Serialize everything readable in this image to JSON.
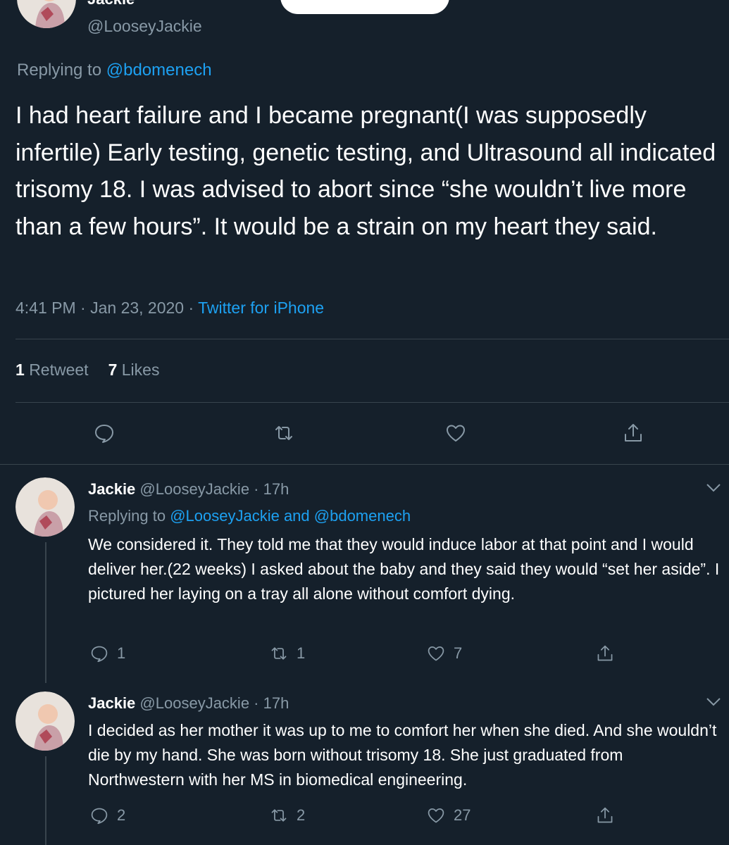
{
  "main_tweet": {
    "name": "Jackie",
    "handle": "@LooseyJackie",
    "replying_prefix": "Replying to",
    "replying_to": "@bdomenech",
    "text": "I had heart failure and I became pregnant(I was supposedly infertile) Early testing, genetic testing, and Ultrasound all indicated trisomy 18. I was advised to abort since “she wouldn’t live more than a few hours”. It would be a strain on my heart they said.",
    "time": "4:41 PM · Jan 23, 2020 · ",
    "source": "Twitter for iPhone",
    "retweet_count": "1",
    "retweet_label": "Retweet",
    "like_count": "7",
    "like_label": "Likes"
  },
  "replies": [
    {
      "name": "Jackie",
      "handle_time": "@LooseyJackie · 17h",
      "replying_prefix": "Replying to",
      "replying_to": "@LooseyJackie and @bdomenech",
      "text": "We considered it. They told me that they would induce labor at that point and I would deliver her.(22 weeks) I asked about the baby and they said they would “set her aside”. I pictured her laying on a tray all alone without comfort dying.",
      "reply_count": "1",
      "retweet_count": "1",
      "like_count": "7"
    },
    {
      "name": "Jackie",
      "handle_time": "@LooseyJackie · 17h",
      "text": "I decided as her mother it was up to me to comfort her when she died. And she wouldn’t die by my hand. She was born without trisomy 18. She just graduated from Northwestern with her MS in biomedical engineering.",
      "reply_count": "2",
      "retweet_count": "2",
      "like_count": "27"
    }
  ],
  "icons": [
    "reply-icon",
    "retweet-icon",
    "like-icon",
    "share-icon",
    "chevron-down-icon",
    "avatar"
  ],
  "colors": {
    "background": "#15202b",
    "muted": "#8899a6",
    "link": "#1da1f2",
    "divider": "#38444d"
  }
}
